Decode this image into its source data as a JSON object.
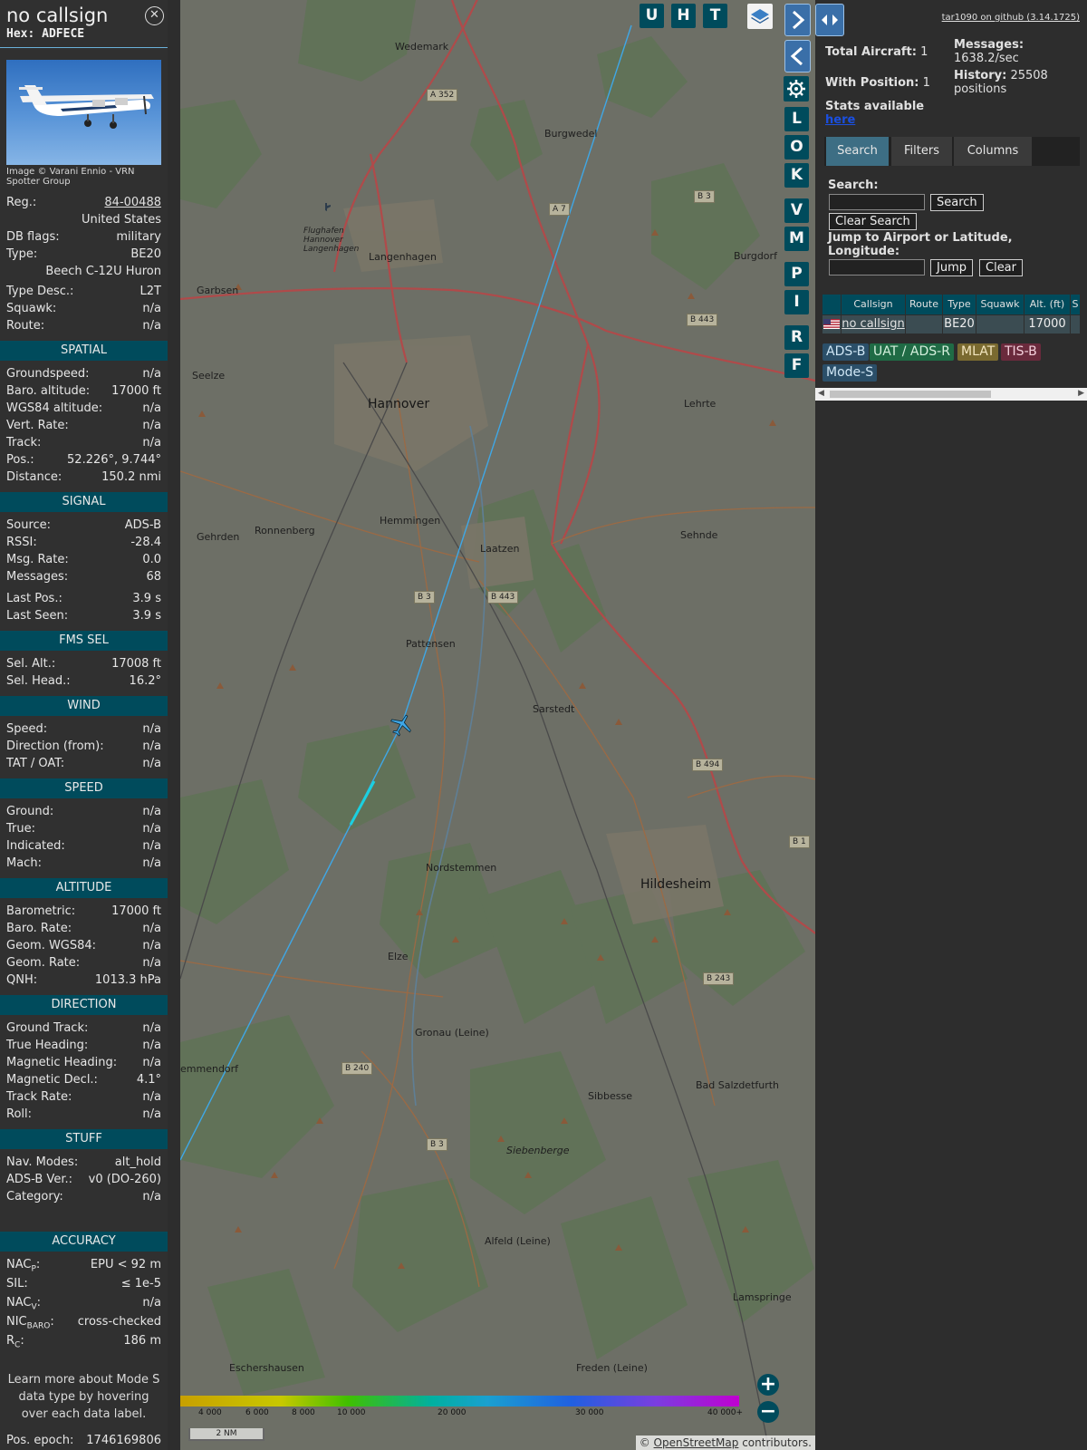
{
  "info": {
    "callsign": "no callsign",
    "hex_label": "Hex:",
    "hex": "ADFECE",
    "photo_credit": "Image © Varani Ennio - VRN Spotter Group",
    "reg_label": "Reg.:",
    "reg": "84-00488",
    "country": "United States",
    "dbflags_label": "DB flags:",
    "dbflags": "military",
    "type_label": "Type:",
    "type": "BE20",
    "type_name": "Beech C-12U Huron",
    "typedesc_label": "Type Desc.:",
    "typedesc": "L2T",
    "squawk_label": "Squawk:",
    "squawk": "n/a",
    "route_label": "Route:",
    "route": "n/a",
    "sections": {
      "spatial": "SPATIAL",
      "signal": "SIGNAL",
      "fms": "FMS SEL",
      "wind": "WIND",
      "speed": "SPEED",
      "altitude": "ALTITUDE",
      "direction": "DIRECTION",
      "stuff": "STUFF",
      "accuracy": "ACCURACY"
    },
    "spatial": [
      {
        "label": "Groundspeed:",
        "value": "n/a"
      },
      {
        "label": "Baro. altitude:",
        "value": "17000 ft"
      },
      {
        "label": "WGS84 altitude:",
        "value": "n/a"
      },
      {
        "label": "Vert. Rate:",
        "value": "n/a"
      },
      {
        "label": "Track:",
        "value": "n/a"
      },
      {
        "label": "Pos.:",
        "value": "52.226°, 9.744°"
      },
      {
        "label": "Distance:",
        "value": "150.2 nmi"
      }
    ],
    "signal": [
      {
        "label": "Source:",
        "value": "ADS-B"
      },
      {
        "label": "RSSI:",
        "value": "-28.4"
      },
      {
        "label": "Msg. Rate:",
        "value": "0.0"
      },
      {
        "label": "Messages:",
        "value": "68"
      },
      {
        "label": "Last Pos.:",
        "value": "3.9 s"
      },
      {
        "label": "Last Seen:",
        "value": "3.9 s"
      }
    ],
    "fms": [
      {
        "label": "Sel. Alt.:",
        "value": "17008 ft"
      },
      {
        "label": "Sel. Head.:",
        "value": "16.2°"
      }
    ],
    "wind": [
      {
        "label": "Speed:",
        "value": "n/a"
      },
      {
        "label": "Direction (from):",
        "value": "n/a"
      },
      {
        "label": "TAT / OAT:",
        "value": "n/a"
      }
    ],
    "speed": [
      {
        "label": "Ground:",
        "value": "n/a"
      },
      {
        "label": "True:",
        "value": "n/a"
      },
      {
        "label": "Indicated:",
        "value": "n/a"
      },
      {
        "label": "Mach:",
        "value": "n/a"
      }
    ],
    "altitude": [
      {
        "label": "Barometric:",
        "value": "17000 ft"
      },
      {
        "label": "Baro. Rate:",
        "value": "n/a"
      },
      {
        "label": "Geom. WGS84:",
        "value": "n/a"
      },
      {
        "label": "Geom. Rate:",
        "value": "n/a"
      },
      {
        "label": "QNH:",
        "value": "1013.3 hPa"
      }
    ],
    "direction": [
      {
        "label": "Ground Track:",
        "value": "n/a"
      },
      {
        "label": "True Heading:",
        "value": "n/a"
      },
      {
        "label": "Magnetic Heading:",
        "value": "n/a"
      },
      {
        "label": "Magnetic Decl.:",
        "value": "4.1°"
      },
      {
        "label": "Track Rate:",
        "value": "n/a"
      },
      {
        "label": "Roll:",
        "value": "n/a"
      }
    ],
    "stuff": [
      {
        "label": "Nav. Modes:",
        "value": "alt_hold"
      },
      {
        "label": "ADS-B Ver.:",
        "value": "v0 (DO-260)"
      },
      {
        "label": "Category:",
        "value": "n/a"
      }
    ],
    "accuracy": {
      "nacp_main": "NAC",
      "nacp_sub": "P",
      "nacp": "EPU < 92 m",
      "sil_label": "SIL:",
      "sil": "≤ 1e-5",
      "nacv_main": "NAC",
      "nacv_sub": "V",
      "nacv": "n/a",
      "nicbaro_main": "NIC",
      "nicbaro_sub": "BARO",
      "nicbaro": "cross-checked",
      "rc_main": "R",
      "rc_sub": "C",
      "rc": "186 m"
    },
    "learn_more": "Learn more about Mode S data type by hovering over each data label.",
    "epoch_label": "Pos. epoch:",
    "epoch": "1746169806"
  },
  "map": {
    "top_buttons": [
      "U",
      "H",
      "T"
    ],
    "side_buttons": [
      "L",
      "O",
      "K",
      "V",
      "M",
      "P",
      "I",
      "R",
      "F"
    ],
    "places": [
      {
        "name": "Wedemark"
      },
      {
        "name": "Burgwedel"
      },
      {
        "name": "Flughafen Hannover Langenhagen"
      },
      {
        "name": "Langenhagen"
      },
      {
        "name": "Garbsen"
      },
      {
        "name": "Burgdorf"
      },
      {
        "name": "Seelze"
      },
      {
        "name": "Hannover"
      },
      {
        "name": "Lehrte"
      },
      {
        "name": "Gehrden"
      },
      {
        "name": "Ronnenberg"
      },
      {
        "name": "Hemmingen"
      },
      {
        "name": "Laatzen"
      },
      {
        "name": "Sehnde"
      },
      {
        "name": "Pattensen"
      },
      {
        "name": "Sarstedt"
      },
      {
        "name": "Nordstemmen"
      },
      {
        "name": "Hildesheim"
      },
      {
        "name": "Elze"
      },
      {
        "name": "Gronau (Leine)"
      },
      {
        "name": "emmendorf"
      },
      {
        "name": "Bad Salzdetfurth"
      },
      {
        "name": "Sibbesse"
      },
      {
        "name": "Siebenberge"
      },
      {
        "name": "Alfeld (Leine)"
      },
      {
        "name": "Lamspringe"
      },
      {
        "name": "Eschershausen"
      },
      {
        "name": "Freden (Leine)"
      }
    ],
    "roads": [
      "A 352",
      "A 7",
      "B 3",
      "B 443",
      "B 3",
      "B 443",
      "B 494",
      "B 1",
      "B 243",
      "B 240",
      "B 3"
    ],
    "altitude_labels": [
      "4 000",
      "6 000",
      "8 000",
      "10 000",
      "20 000",
      "30 000",
      "40 000+"
    ],
    "scale": "2 NM",
    "attribution_prefix": "© ",
    "attribution_link": "OpenStreetMap",
    "attribution_suffix": " contributors."
  },
  "sidebar": {
    "github": "tar1090 on github (3.14.1725)",
    "total_label": "Total Aircraft:",
    "total": "1",
    "withpos_label": "With Position:",
    "withpos": "1",
    "messages_label": "Messages:",
    "messages": "1638.2/sec",
    "history_label": "History:",
    "history": "25508 positions",
    "stats_text": "Stats available",
    "stats_link": "here",
    "tabs": [
      "Search",
      "Filters",
      "Columns"
    ],
    "search_label": "Search:",
    "search_btn": "Search",
    "clear_search_btn": "Clear Search",
    "jump_label": "Jump to Airport or Latitude, Longitude:",
    "jump_btn": "Jump",
    "clear_btn": "Clear",
    "columns": [
      "Callsign",
      "Route",
      "Type",
      "Squawk",
      "Alt. (ft)",
      "S"
    ],
    "row": {
      "callsign": "no callsign",
      "route": "",
      "type": "BE20",
      "squawk": "",
      "alt": "17000"
    },
    "legend": [
      "ADS-B",
      "UAT / ADS-R",
      "MLAT",
      "TIS-B",
      "Mode-S"
    ]
  },
  "colors": {
    "accent": "#004b5c",
    "track": "#3fa7e6",
    "adsb": "#2b4f69",
    "uat": "#1f6b45",
    "mlat": "#7a6a30",
    "tisb": "#6a2a3c",
    "modes": "#2b4f69"
  }
}
